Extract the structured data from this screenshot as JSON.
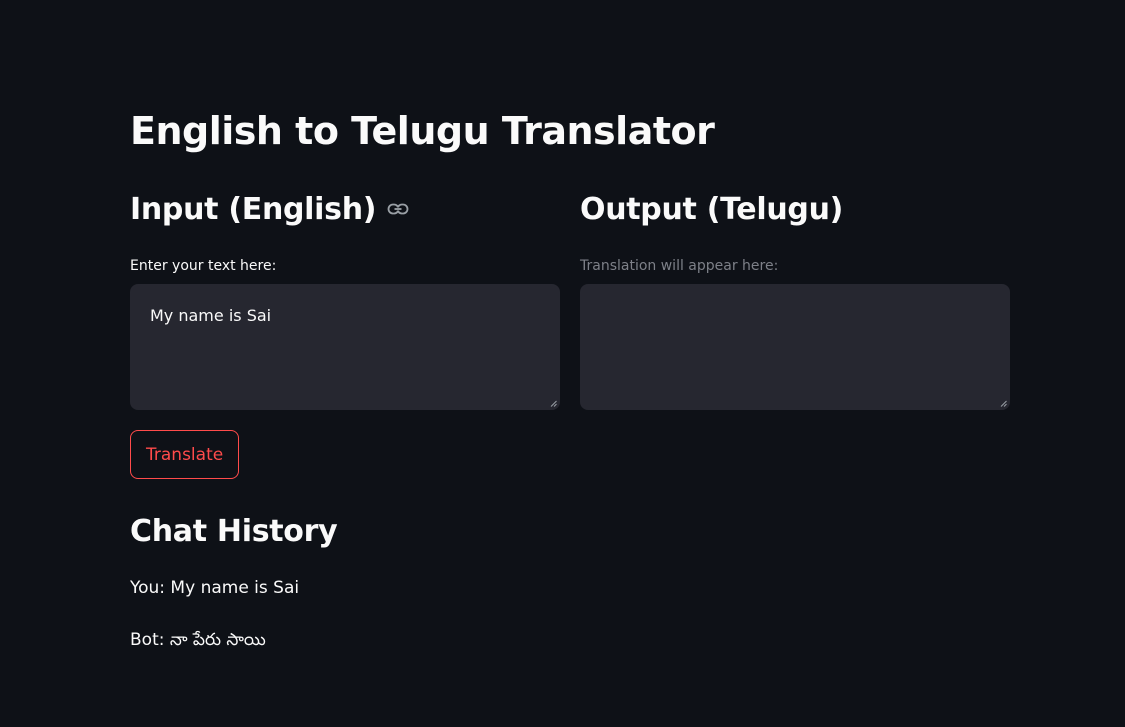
{
  "app": {
    "title": "English to Telugu Translator"
  },
  "input": {
    "heading": "Input (English)",
    "link_icon": "link-icon",
    "label": "Enter your text here:",
    "value": "My name is Sai"
  },
  "output": {
    "heading": "Output (Telugu)",
    "label": "Translation will appear here:",
    "value": ""
  },
  "actions": {
    "translate_label": "Translate"
  },
  "history": {
    "heading": "Chat History",
    "entries": [
      {
        "text": "You: My name is Sai"
      },
      {
        "text": "Bot: నా పేరు సాయి"
      }
    ]
  },
  "colors": {
    "background": "#0e1117",
    "surface": "#262730",
    "text": "#fafafa",
    "muted": "#7d8088",
    "accent": "#ff4b4b"
  }
}
